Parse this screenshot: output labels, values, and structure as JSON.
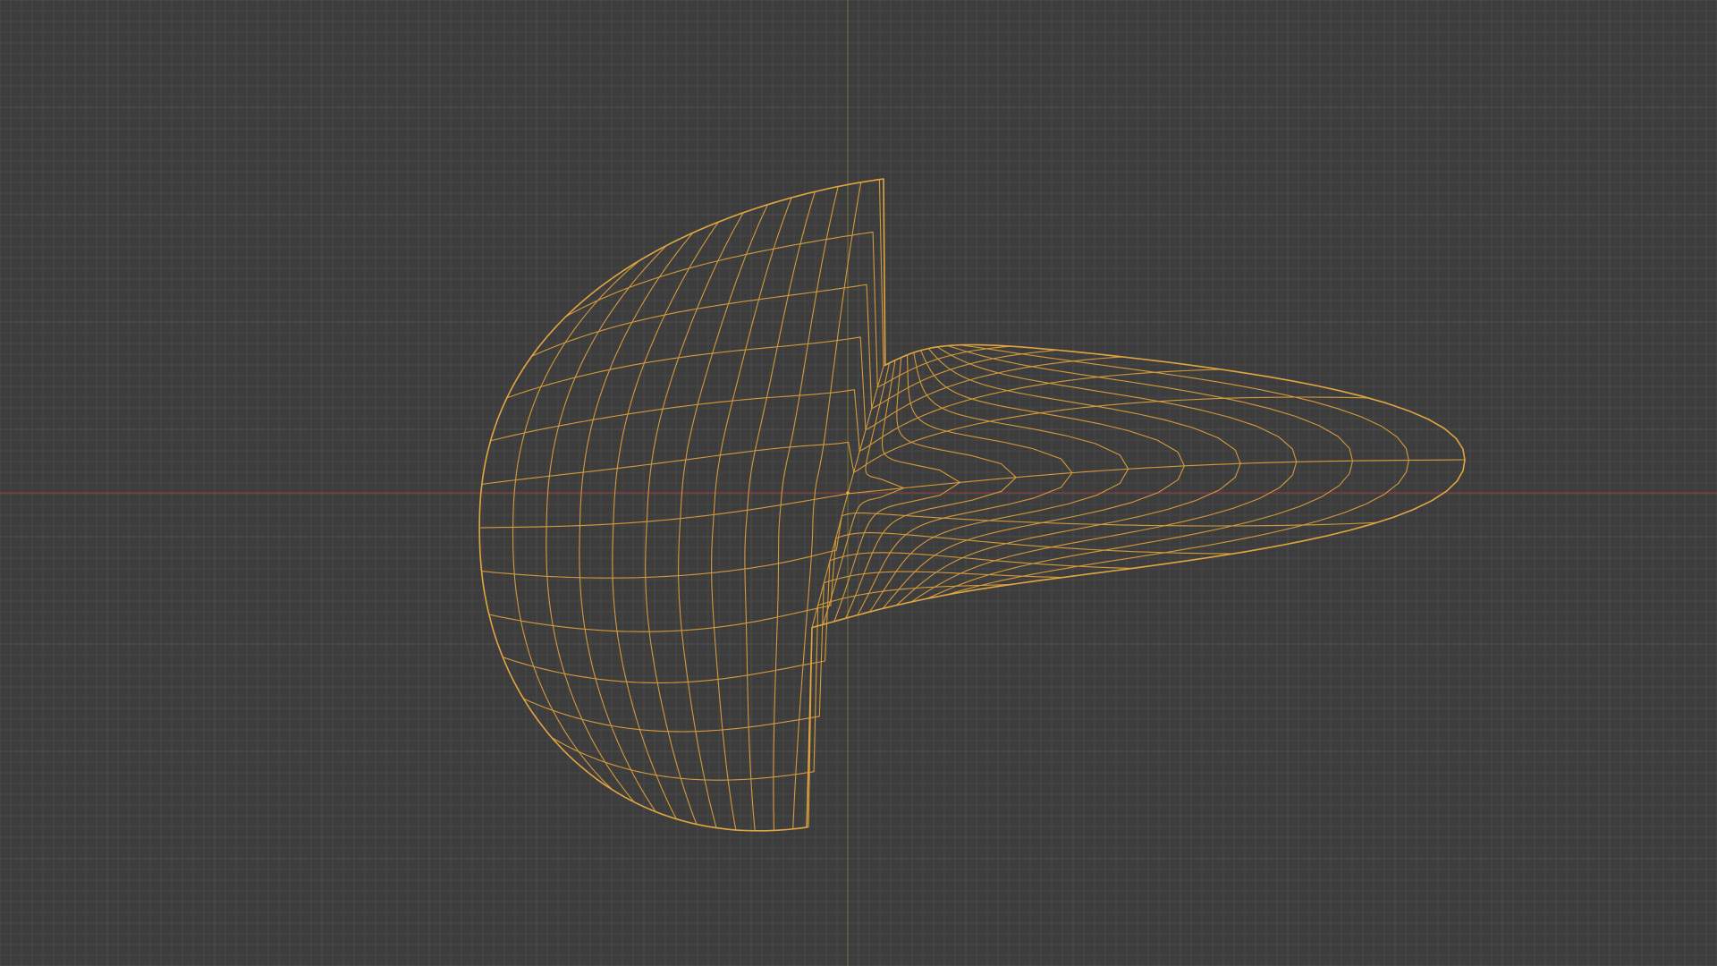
{
  "viewport": {
    "mode": "wireframe",
    "view": "top-orthographic"
  },
  "colors": {
    "background": "#3d3d3d",
    "grid_minor": "#474747",
    "grid_major": "#4e4e4e",
    "axis_x": "#8a3d3d",
    "axis_y": "#6b6b3a",
    "wire": "#d49a3a",
    "wire_outline": "#e0a540",
    "origin_dot": "#e8b040"
  },
  "mesh": {
    "object_selected": true,
    "origin_visible": true
  }
}
